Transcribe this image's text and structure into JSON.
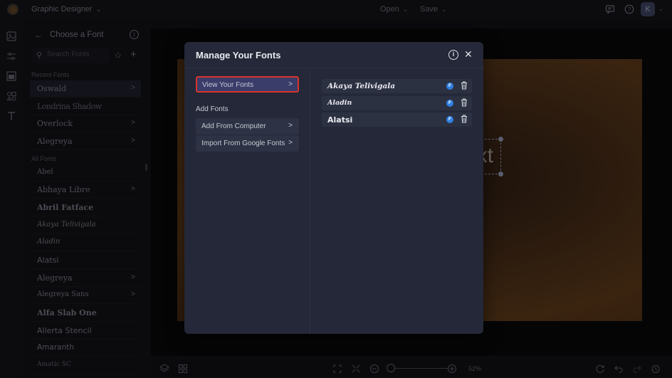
{
  "topbar": {
    "project_name": "Graphic Designer",
    "open_label": "Open",
    "save_label": "Save",
    "avatar_initial": "K"
  },
  "font_panel": {
    "title": "Choose a Font",
    "search_placeholder": "Search Fonts",
    "recent_label": "Recent Fonts",
    "recent_fonts": [
      {
        "name": "Oswald",
        "has_submenu": true
      },
      {
        "name": "Londrina Shadow",
        "has_submenu": false
      },
      {
        "name": "Overlock",
        "has_submenu": true
      },
      {
        "name": "Alegreya",
        "has_submenu": true
      }
    ],
    "all_label": "All Fonts",
    "all_fonts": [
      {
        "name": "Abel",
        "has_submenu": false
      },
      {
        "name": "Abhaya Libre",
        "has_submenu": true
      },
      {
        "name": "Abril Fatface",
        "has_submenu": false
      },
      {
        "name": "Akaya Telivigala",
        "has_submenu": false
      },
      {
        "name": "Aladin",
        "has_submenu": false
      },
      {
        "name": "Alatsi",
        "has_submenu": false
      },
      {
        "name": "Alegreya",
        "has_submenu": true
      },
      {
        "name": "Alegreya Sans",
        "has_submenu": true
      },
      {
        "name": "Alfa Slab One",
        "has_submenu": false
      },
      {
        "name": "Allerta Stencil",
        "has_submenu": false
      },
      {
        "name": "Amaranth",
        "has_submenu": false
      },
      {
        "name": "Amatic SC",
        "has_submenu": false
      }
    ]
  },
  "canvas": {
    "text_fragment": "xt"
  },
  "bottombar": {
    "zoom_level": "52%",
    "zoom_fraction": 0.05
  },
  "modal": {
    "title": "Manage Your Fonts",
    "view_fonts_label": "View Your Fonts",
    "add_fonts_label": "Add Fonts",
    "add_from_computer_label": "Add From Computer",
    "import_google_label": "Import From Google Fonts",
    "fonts": [
      {
        "name": "Akaya Telivigala",
        "badge": "F"
      },
      {
        "name": "Aladin",
        "badge": "F"
      },
      {
        "name": "Alatsi",
        "badge": "F"
      }
    ],
    "colors": {
      "selected_border": "#d8352a",
      "badge": "#2f7fe0",
      "background": "#242838"
    }
  }
}
